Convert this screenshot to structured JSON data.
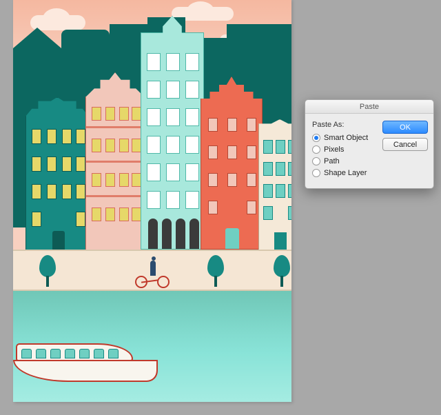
{
  "dialog": {
    "title": "Paste",
    "group_label": "Paste As:",
    "options": [
      {
        "label": "Smart Object",
        "checked": true
      },
      {
        "label": "Pixels",
        "checked": false
      },
      {
        "label": "Path",
        "checked": false
      },
      {
        "label": "Shape Layer",
        "checked": false
      }
    ],
    "ok_label": "OK",
    "cancel_label": "Cancel"
  },
  "colors": {
    "app_bg": "#a8a8a8",
    "sky": "#f5b8a0",
    "silhouette": "#0c6760",
    "teal": "#178a83",
    "mint": "#a8e8dc",
    "red": "#ed6b52",
    "water": "#5fd4c5",
    "primary_button": "#2d8bff"
  }
}
